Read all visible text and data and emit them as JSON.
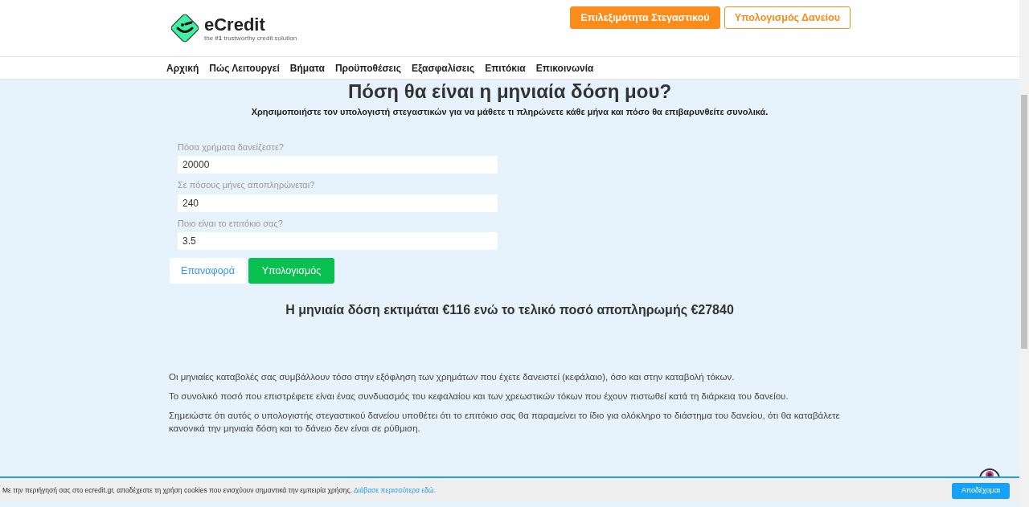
{
  "logo": {
    "name": "eCredit",
    "tagline": "the **#1** trustworthy credit solution"
  },
  "header_buttons": [
    {
      "label": "Επιλεξιμότητα Στεγαστικού",
      "kind": "primary"
    },
    {
      "label": "Υπολογισμός Δανείου",
      "kind": "outline"
    }
  ],
  "nav": [
    "Αρχική",
    "Πώς Λειτουργεί",
    "Βήματα",
    "Προϋποθέσεις",
    "Εξασφαλίσεις",
    "Επιτόκια",
    "Επικοινωνία"
  ],
  "heading": "Πόση θα είναι η μηνιαία δόση μου?",
  "subheading": "Χρησιμοποιήστε τον υπολογιστή στεγαστικών για να μάθετε τι πληρώνετε κάθε μήνα και πόσο θα επιβαρυνθείτε συνολικά.",
  "fields": [
    {
      "label": "Πόσα χρήματα δανείζεστε?",
      "value": "20000"
    },
    {
      "label": "Σε πόσους μήνες αποπληρώνεται?",
      "value": "240"
    },
    {
      "label": "Ποιο είναι το επιτόκιο σας?",
      "value": "3.5"
    }
  ],
  "form_buttons": [
    {
      "label": "Επαναφορά",
      "kind": "reset"
    },
    {
      "label": "Υπολογισμός",
      "kind": "submit"
    }
  ],
  "result": "Η μηνιαία δόση εκτιμάται €116 ενώ το τελικό ποσό αποπληρωμής €27840",
  "paragraphs": [
    "Οι μηνιαίες καταβολές σας συμβάλλουν τόσο στην εξόφληση των χρημάτων που έχετε δανειστεί (κεφάλαιο), όσο και στην καταβολή τόκων.",
    "Το συνολικό ποσό που επιστρέφετε είναι ένας συνδυασμός του κεφαλαίου και των χρεωστικών τόκων που έχουν πιστωθεί κατά τη διάρκεια του δανείου.",
    "Σημειώστε ότι αυτός ο υπολογιστής στεγαστικού δανείου υποθέτει ότι το επιτόκιο σας θα παραμείνει το ίδιο για ολόκληρο το διάστημα του δανείου, ότι θα καταβάλετε κανονικά την μηνιαία δόση και το δάνειο δεν είναι σε ρύθμιση."
  ],
  "cookie_bar": {
    "text": "Με την περιήγησή σας στο ecredit.gr, αποδέχεστε τη χρήση cookies που ενισχύουν σημαντικά την εμπειρία χρήσης.",
    "link": "Διάβασε περισσότερα εδώ.",
    "button": "Αποδέχομαι"
  }
}
